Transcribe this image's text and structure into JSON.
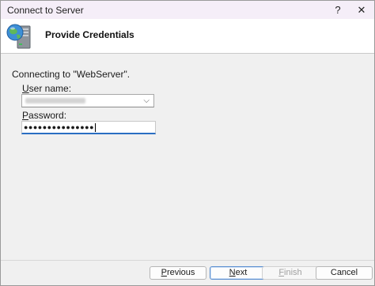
{
  "window": {
    "title": "Connect to Server",
    "help_glyph": "?",
    "close_glyph": "✕"
  },
  "banner": {
    "heading": "Provide Credentials",
    "icon": "server-globe-icon"
  },
  "form": {
    "connecting_text": "Connecting to \"WebServer\".",
    "username": {
      "label_access_key": "U",
      "label_rest": "ser name:",
      "value": "",
      "dropdown_icon": "chevron-down-icon"
    },
    "password": {
      "label_access_key": "P",
      "label_rest": "assword:",
      "masked_value": "●●●●●●●●●●●●●●●"
    }
  },
  "footer": {
    "previous": {
      "key": "P",
      "rest": "revious"
    },
    "next": {
      "key": "N",
      "rest": "ext"
    },
    "finish": {
      "key": "F",
      "rest": "inish"
    },
    "cancel": "Cancel"
  }
}
